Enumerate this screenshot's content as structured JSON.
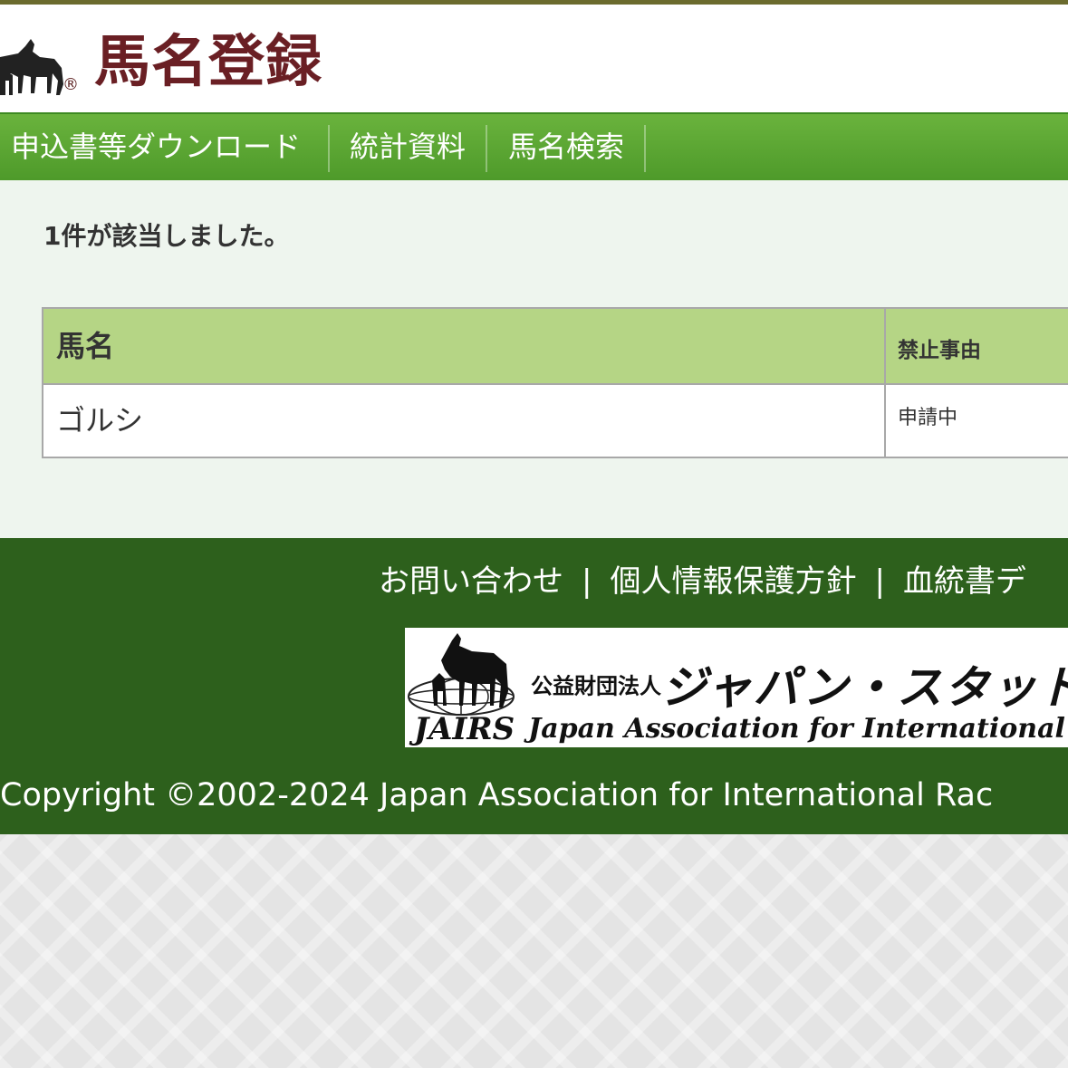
{
  "header": {
    "logo_text": "馬名登録",
    "registered_mark": "®",
    "logo_icon": "horses-icon"
  },
  "nav": {
    "items": [
      {
        "label": "申込書等ダウンロード"
      },
      {
        "label": "統計資料"
      },
      {
        "label": "馬名検索"
      }
    ]
  },
  "main": {
    "result_count": "1件が該当しました。",
    "table": {
      "headers": {
        "name": "馬名",
        "reason": "禁止事由"
      },
      "rows": [
        {
          "name": "ゴルシ",
          "reason": "申請中"
        }
      ]
    }
  },
  "footer": {
    "links": [
      "お問い合わせ",
      "個人情報保護方針",
      "血統書デ"
    ],
    "separator": "|",
    "banner": {
      "org_prefix": "公益財団法人",
      "org_name_jp": "ジャパン・スタッドブック・",
      "mark": "JAIRS",
      "org_name_en": "Japan Association for International Ra"
    },
    "copyright": "Copyright ©2002-2024 Japan Association for International Rac"
  },
  "colors": {
    "nav_green": "#5aa632",
    "footer_green": "#2d601c",
    "table_header": "#b5d585",
    "logo_maroon": "#6a1f24"
  }
}
